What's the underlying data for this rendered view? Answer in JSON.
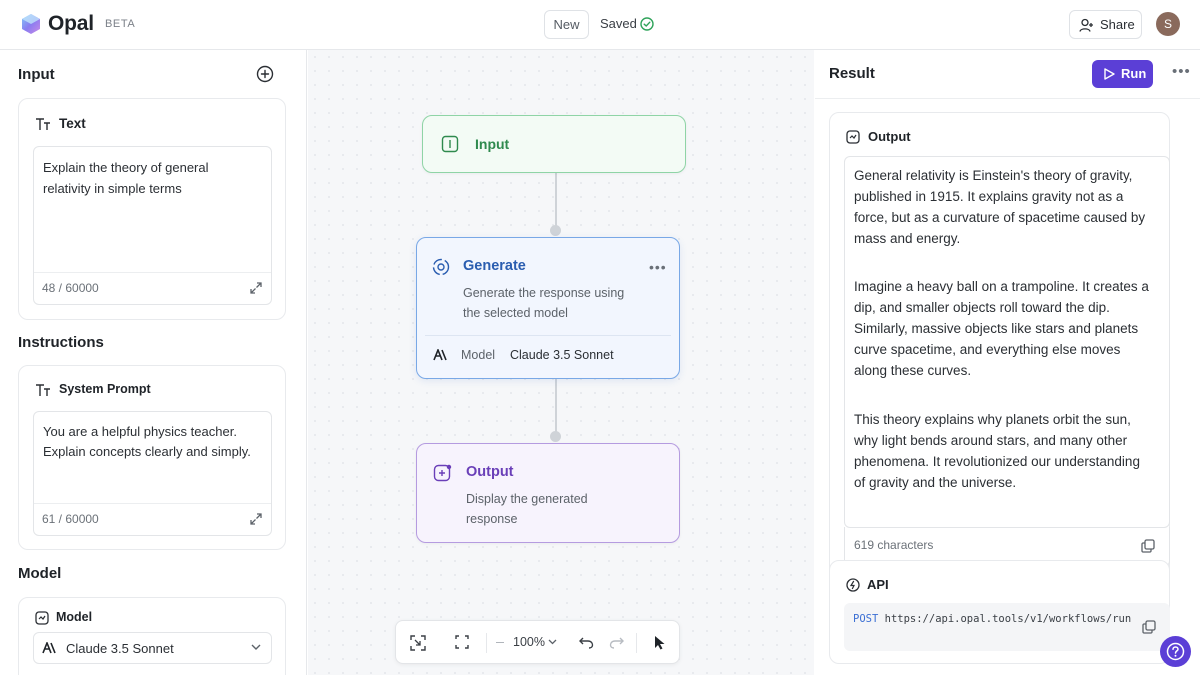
{
  "app": {
    "name": "Opal",
    "badge": "BETA"
  },
  "header": {
    "new_label": "New",
    "saved_label": "Saved",
    "share_label": "Share",
    "avatar_initial": "S"
  },
  "left": {
    "input_title": "Input",
    "text_card": {
      "title": "Text",
      "value": "Explain the theory of general relativity in simple terms",
      "count": "48 / 60000"
    },
    "instructions_title": "Instructions",
    "prompt_card": {
      "title": "System Prompt",
      "value": "You are a helpful physics teacher. Explain concepts clearly and simply.",
      "count": "61 / 60000"
    },
    "model_title": "Model",
    "model_card": {
      "title": "Model",
      "selected": "Claude 3.5 Sonnet"
    }
  },
  "canvas": {
    "input_node": {
      "title": "Input"
    },
    "generate_node": {
      "title": "Generate",
      "description": "Generate the response using the selected model",
      "model_label": "Model",
      "model_value": "Claude 3.5 Sonnet"
    },
    "output_node": {
      "title": "Output",
      "description": "Display the generated response"
    },
    "toolbar": {
      "zoom": "100%"
    }
  },
  "right": {
    "title": "Result",
    "run_label": "Run",
    "output_title": "Output",
    "output_paragraphs": [
      "General relativity is Einstein's theory of gravity, published in 1915. It explains gravity not as a force, but as a curvature of spacetime caused by mass and energy.",
      "Imagine a heavy ball on a trampoline. It creates a dip, and smaller objects roll toward the dip. Similarly, massive objects like stars and planets curve spacetime, and everything else moves along these curves.",
      "This theory explains why planets orbit the sun, why light bends around stars, and many other phenomena. It revolutionized our understanding of gravity and the universe."
    ],
    "char_count": "619 characters",
    "api_title": "API",
    "api_method": "POST",
    "api_url": "https://api.opal.tools/v1/workflows/run"
  },
  "colors": {
    "accent": "#5b3fd6",
    "input_node": "#2f8a4e",
    "generate_node": "#2a5db0",
    "output_node": "#6a3fb8"
  },
  "icons": [
    "logo-icon",
    "check-circle-icon",
    "share-user-icon",
    "add-circle-icon",
    "text-format-icon",
    "expand-icon",
    "model-icon",
    "anthropic-icon",
    "chevron-down-icon",
    "input-icon",
    "generate-icon",
    "output-icon",
    "fit-view-icon",
    "fullscreen-icon",
    "undo-icon",
    "redo-icon",
    "cursor-icon",
    "play-icon",
    "more-icon",
    "copy-icon",
    "api-icon",
    "help-icon"
  ]
}
